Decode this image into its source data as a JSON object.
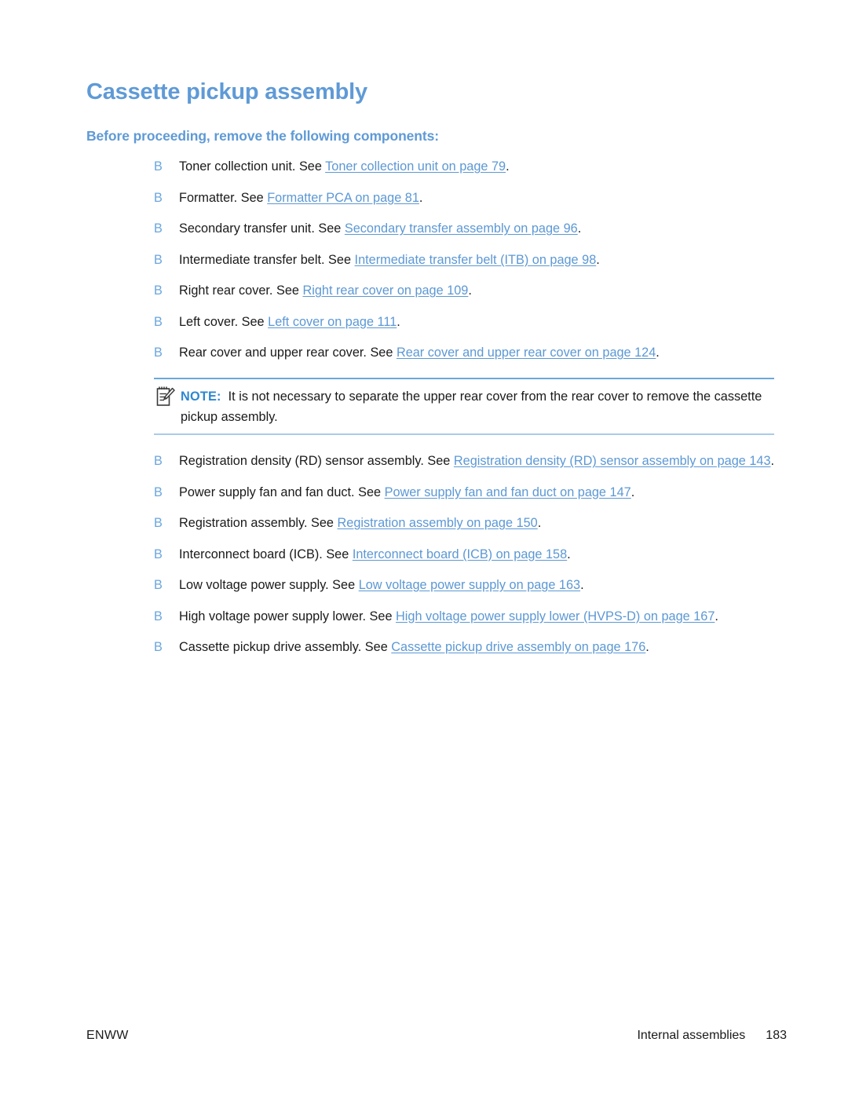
{
  "document": {
    "title": "Cassette pickup assembly",
    "subtitle": "Before proceeding, remove the following components:",
    "bullet_glyph": "B",
    "accent_color": "#5f9ad6",
    "link_color": "#5c98d4",
    "note_label_color": "#2e87d0"
  },
  "components": [
    {
      "pre": "Toner collection unit. See ",
      "link": "Toner collection unit on page 79",
      "post": "."
    },
    {
      "pre": "Formatter. See ",
      "link": "Formatter PCA on page 81",
      "post": "."
    },
    {
      "pre": "Secondary transfer unit. See ",
      "link": "Secondary transfer assembly on page 96",
      "post": "."
    },
    {
      "pre": "Intermediate transfer belt. See ",
      "link": "Intermediate transfer belt (ITB) on page 98",
      "post": "."
    },
    {
      "pre": "Right rear cover. See ",
      "link": "Right rear cover on page 109",
      "post": "."
    },
    {
      "pre": "Left cover. See ",
      "link": "Left cover on page 111",
      "post": "."
    },
    {
      "pre": "Rear cover and upper rear cover. See ",
      "link": "Rear cover and upper rear cover on page 124",
      "post": "."
    }
  ],
  "note": {
    "icon": "notepad-pencil-icon",
    "label": "NOTE:",
    "text": "It is not necessary to separate the upper rear cover from the rear cover to remove the cassette pickup assembly."
  },
  "components_after_note": [
    {
      "pre": "Registration density (RD) sensor assembly. See ",
      "link": "Registration density (RD) sensor assembly on page 143",
      "post": "."
    },
    {
      "pre": "Power supply fan and fan duct. See ",
      "link": "Power supply fan and fan duct on page 147",
      "post": "."
    },
    {
      "pre": "Registration assembly. See ",
      "link": "Registration assembly on page 150",
      "post": "."
    },
    {
      "pre": "Interconnect board (ICB). See ",
      "link": "Interconnect board (ICB) on page 158",
      "post": "."
    },
    {
      "pre": "Low voltage power supply. See ",
      "link": "Low voltage power supply on page 163",
      "post": "."
    },
    {
      "pre": "High voltage power supply lower. See ",
      "link": "High voltage power supply lower (HVPS-D) on page 167",
      "post": "."
    },
    {
      "pre": "Cassette pickup drive assembly. See ",
      "link": "Cassette pickup drive assembly on page 176",
      "post": "."
    }
  ],
  "footer": {
    "left": "ENWW",
    "section": "Internal assemblies",
    "page_number": "183"
  }
}
